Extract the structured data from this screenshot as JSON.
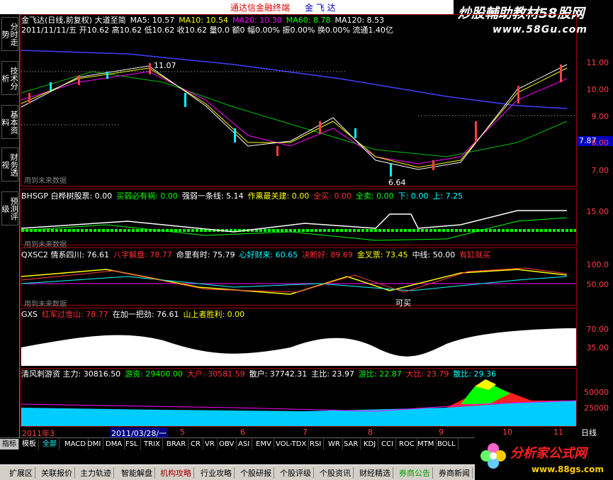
{
  "title": {
    "app": "通达信金融终端",
    "stock": "金 飞 达"
  },
  "brand": {
    "line1": "炒股輔助教材58股网",
    "line2": "www.58Gu.com"
  },
  "sidebar": [
    "分时走势",
    "技术分析",
    "基本资料",
    "财务透视",
    "预测评级"
  ],
  "main": {
    "header": [
      "金飞达(日线,前复权) 大道至简",
      "MA5: 10.57",
      "MA10: 10.54",
      "MA20: 10.30",
      "MA60: 8.78",
      "MA120: 8.53"
    ],
    "info": [
      "2011/11/11/五 开10.62 高10.62 低10.62 收10.62 量0.0 额0 幅0.00% 振0.00% 换0.00% 流通1.40亿"
    ],
    "labels": {
      "high": "11.07",
      "low": "6.64",
      "price": "7.87",
      "future": "用到未来数据"
    },
    "yaxis": [
      "11.00",
      "10.00",
      "9.00",
      "8.00",
      "7.00"
    ]
  },
  "p2": {
    "items": [
      "BHSGP 白桦树股票: 0.00",
      "买弱必有祸: 0.00",
      "强弱一条线: 5.14",
      "作熏最关建: 0.00",
      "全买: 0.00",
      "全卖: 0.00",
      "下: 0.00",
      "上: 7.25"
    ],
    "yaxis": [
      "15.00"
    ],
    "future": "用到未来数据"
  },
  "p3": {
    "items": [
      "QXSC2 情系四川: 76.61",
      "八字解盘: 78.77",
      "命里有时: 75.79",
      "心好财来: 60.65",
      "决断好: 89.69",
      "金叉票: 73.45",
      "中线: 50.00",
      "有缸就买"
    ],
    "yaxis": [
      "100.0",
      "50.00"
    ],
    "buy": "可买",
    "future": "用到未来数据"
  },
  "p4": {
    "items": [
      "GXS",
      "红军过雪山: 78.77",
      "在加一把劲: 76.61",
      "山上者胜利: 0.00"
    ],
    "yaxis": [
      "70.00",
      "35.00"
    ]
  },
  "p5": {
    "items": [
      "清风刺游资 主力: 30816.50",
      "游资: 29400.00",
      "大户: 30581.59",
      "散户: 37742.31",
      "主比: 23.97",
      "游比: 22.87",
      "大比: 23.79",
      "散比: 29.36"
    ],
    "yaxis": [
      "50000",
      "25000"
    ]
  },
  "xaxis": {
    "labels": [
      "2011年3",
      "2011/03/28/一",
      "5",
      "6",
      "7",
      "8",
      "9",
      "10",
      "11"
    ],
    "right": "日线"
  },
  "tabs": [
    "指标",
    "模板",
    "全部",
    "MACD",
    "DMI",
    "DMA",
    "FSL",
    "TRIX",
    "BRAR",
    "CR",
    "VR",
    "OBV",
    "ASI",
    "EMV",
    "VOL-TDX",
    "RSI",
    "WR",
    "SAR",
    "KDJ",
    "CCI",
    "ROC",
    "MTM",
    "BOLL"
  ],
  "bottom": [
    "扩展区",
    "关联报价",
    "主力轨迹",
    "智能解盘",
    "机构攻略",
    "行业攻略",
    "个股研报",
    "个股评级",
    "个股资讯",
    "财经精选",
    "券商公告",
    "券商新闻"
  ],
  "logo": {
    "name": "分析家公式网",
    "url": "www.88gs.com"
  }
}
